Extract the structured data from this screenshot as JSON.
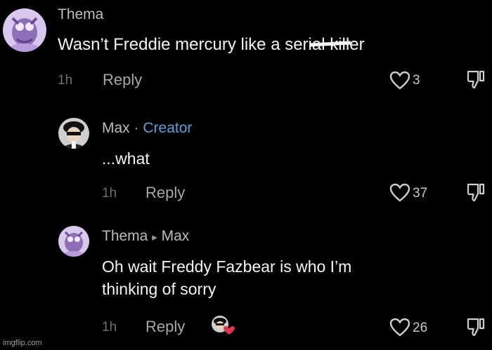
{
  "comments": [
    {
      "author": "Thema",
      "text_before": "Wasn’t Freddie mercury like a seri",
      "text_struck": "al kill",
      "text_after": "er",
      "time": "1h",
      "reply_label": "Reply",
      "likes": "3"
    },
    {
      "author": "Max",
      "separator": "·",
      "badge": "Creator",
      "text": "...what",
      "time": "1h",
      "reply_label": "Reply",
      "likes": "37"
    },
    {
      "author": "Thema",
      "reply_arrow": "▸",
      "reply_to": "Max",
      "text_line1": "Oh wait Freddy Fazbear is who I’m",
      "text_line2": "thinking of sorry",
      "time": "1h",
      "reply_label": "Reply",
      "likes": "26"
    }
  ],
  "watermark": "imgflip.com",
  "icons": {
    "like": "heart-outline-icon",
    "dislike": "thumbs-down-icon",
    "creator_liked": "creator-liked-heart-icon"
  },
  "colors": {
    "background": "#000000",
    "creator_badge": "#5aa0d8",
    "liked_heart": "#e0344a"
  }
}
